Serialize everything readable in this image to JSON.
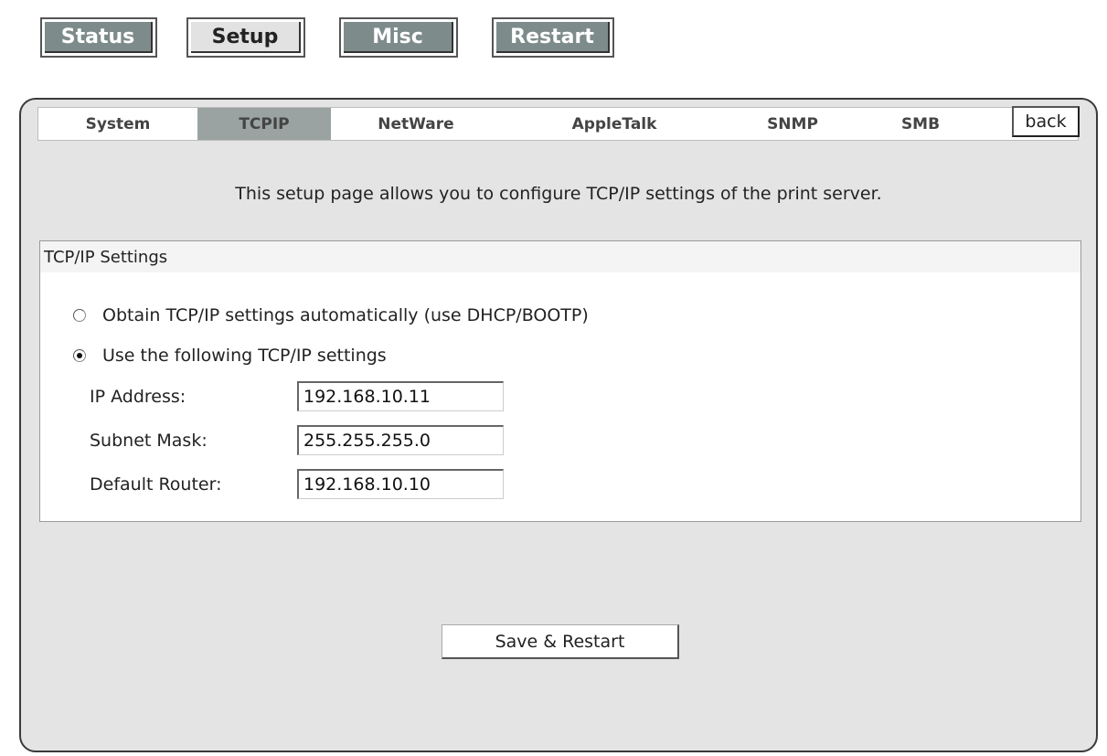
{
  "topnav": {
    "items": [
      {
        "label": "Status"
      },
      {
        "label": "Setup"
      },
      {
        "label": "Misc"
      },
      {
        "label": "Restart"
      }
    ]
  },
  "tabs": [
    {
      "label": "System",
      "active": false
    },
    {
      "label": "TCPIP",
      "active": true
    },
    {
      "label": "NetWare",
      "active": false
    },
    {
      "label": "AppleTalk",
      "active": false
    },
    {
      "label": "SNMP",
      "active": false
    },
    {
      "label": "SMB",
      "active": false
    }
  ],
  "back_label": "back",
  "intro": "This setup page allows you to configure TCP/IP settings of the print server.",
  "settings": {
    "title": "TCP/IP Settings",
    "options": [
      {
        "label": "Obtain TCP/IP settings automatically (use DHCP/BOOTP)",
        "checked": false
      },
      {
        "label": "Use the following TCP/IP settings",
        "checked": true
      }
    ],
    "fields": [
      {
        "label": "IP Address:",
        "value": "192.168.10.11"
      },
      {
        "label": "Subnet Mask:",
        "value": "255.255.255.0"
      },
      {
        "label": "Default Router:",
        "value": "192.168.10.10"
      }
    ]
  },
  "save_label": "Save & Restart",
  "colors": {
    "active_tab": "#9aa3a1",
    "nav_dark": "#7d8c8a",
    "panel_bg": "#e4e4e4"
  }
}
